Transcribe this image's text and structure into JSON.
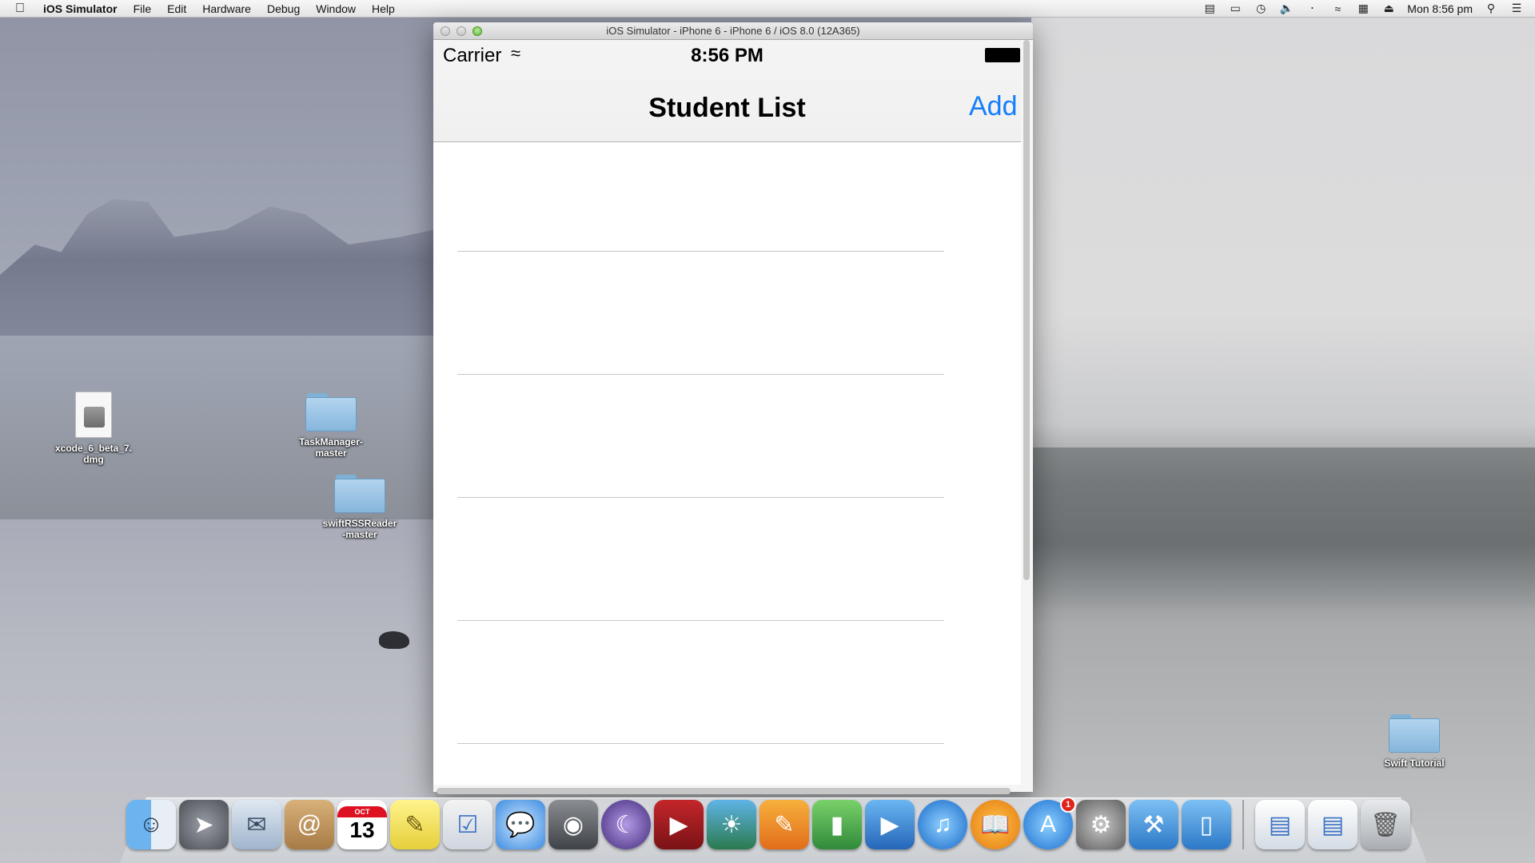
{
  "menubar": {
    "app_name": "iOS Simulator",
    "items": [
      "File",
      "Edit",
      "Hardware",
      "Debug",
      "Window",
      "Help"
    ],
    "clock": "Mon 8:56 pm"
  },
  "desktop": {
    "icons": [
      {
        "label": "xcode_6_beta_7.\ndmg"
      },
      {
        "label": "TaskManager-\nmaster"
      },
      {
        "label": "swiftRSSReader\n-master"
      },
      {
        "label": "Swift Tutorial"
      }
    ]
  },
  "window": {
    "title": "iOS Simulator - iPhone 6 - iPhone 6 / iOS 8.0 (12A365)"
  },
  "device": {
    "carrier": "Carrier",
    "time": "8:56 PM",
    "nav_title": "Student List",
    "nav_add": "Add",
    "rows": [
      "",
      "",
      "",
      "",
      ""
    ]
  },
  "dock": {
    "app_store_badge": "1",
    "calendar_month": "OCT",
    "calendar_day": "13"
  },
  "colors": {
    "ios_blue": "#147efb",
    "separator": "#c8c7cc"
  }
}
